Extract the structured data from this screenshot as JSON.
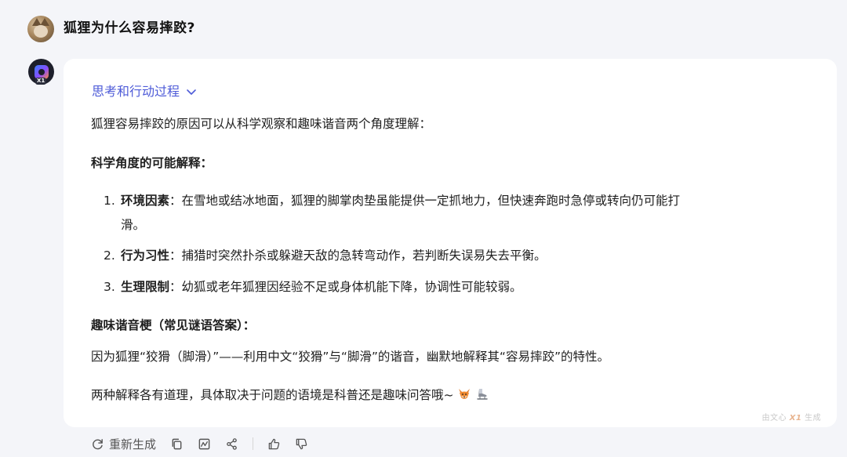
{
  "question": "狐狸为什么容易摔跤?",
  "bot": {
    "badge": "X1"
  },
  "answer": {
    "thinking_label": "思考和行动过程",
    "intro": "狐狸容易摔跤的原因可以从科学观察和趣味谐音两个角度理解：",
    "section1_title": "科学角度的可能解释：",
    "items": [
      {
        "num": "1.",
        "title": "环境因素",
        "text": "：在雪地或结冰地面，狐狸的脚掌肉垫虽能提供一定抓地力，但快速奔跑时急停或转向仍可能打",
        "cont": "滑。"
      },
      {
        "num": "2.",
        "title": "行为习性",
        "text": "：捕猎时突然扑杀或躲避天敌的急转弯动作，若判断失误易失去平衡。"
      },
      {
        "num": "3.",
        "title": "生理限制",
        "text": "：幼狐或老年狐狸因经验不足或身体机能下降，协调性可能较弱。"
      }
    ],
    "section2_title": "趣味谐音梗（常见谜语答案）：",
    "pun": "因为狐狸“狡猾（脚滑）”——利用中文“狡猾”与“脚滑”的谐音，幽默地解释其“容易摔跤”的特性。",
    "conclusion": "两种解释各有道理，具体取决于问题的语境是科普还是趣味问答哦~",
    "watermark_prefix": "由文心",
    "watermark_brand": "X1",
    "watermark_suffix": "生成"
  },
  "actions": {
    "regenerate": "重新生成"
  },
  "colors": {
    "accent": "#4e5bd8",
    "bg": "#f4f5f9",
    "card": "#ffffff"
  }
}
